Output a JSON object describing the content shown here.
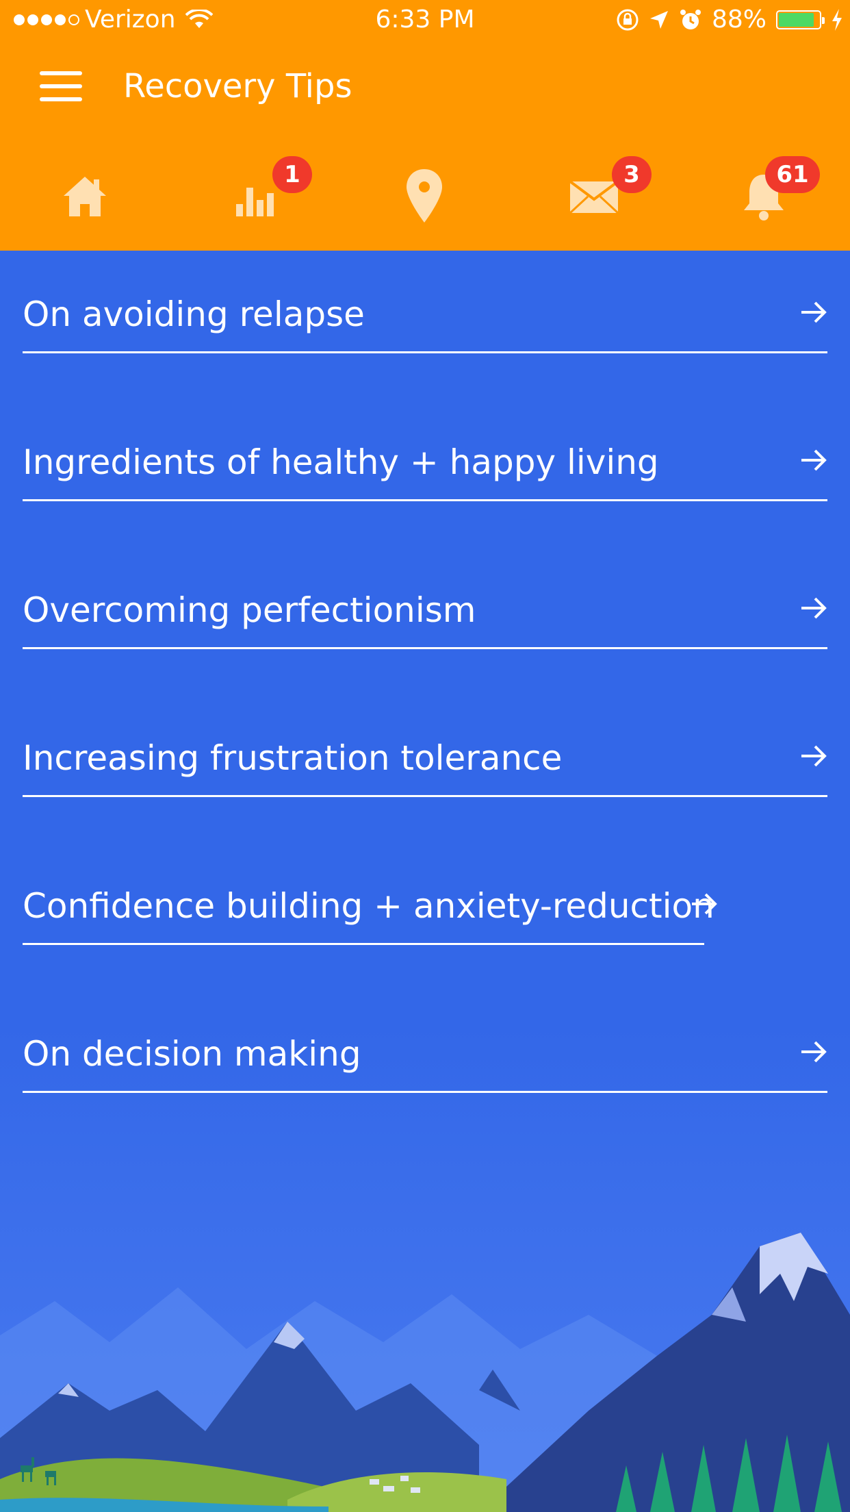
{
  "status_bar": {
    "carrier": "Verizon",
    "time": "6:33 PM",
    "battery_percent": "88%",
    "battery_level": 0.88,
    "signal_dots_filled": 4,
    "signal_dots_total": 5
  },
  "app_bar": {
    "title": "Recovery Tips",
    "menu_icon": "hamburger-menu-icon",
    "tabs": [
      {
        "icon": "home-icon",
        "badge": ""
      },
      {
        "icon": "bar-chart-icon",
        "badge": "1"
      },
      {
        "icon": "location-pin-icon",
        "badge": ""
      },
      {
        "icon": "mail-icon",
        "badge": "3"
      },
      {
        "icon": "bell-icon",
        "badge": "61"
      }
    ]
  },
  "tips": [
    {
      "label": "On avoiding relapse"
    },
    {
      "label": "Ingredients of healthy + happy living"
    },
    {
      "label": "Overcoming perfectionism"
    },
    {
      "label": "Increasing frustration tolerance"
    },
    {
      "label": "Confidence building + anxiety-reduction"
    },
    {
      "label": "On decision making"
    }
  ],
  "colors": {
    "app_bar": "#FF9800",
    "background": "#3367E8",
    "badge": "#F0392B",
    "icon_tint": "#FFE0B2"
  }
}
